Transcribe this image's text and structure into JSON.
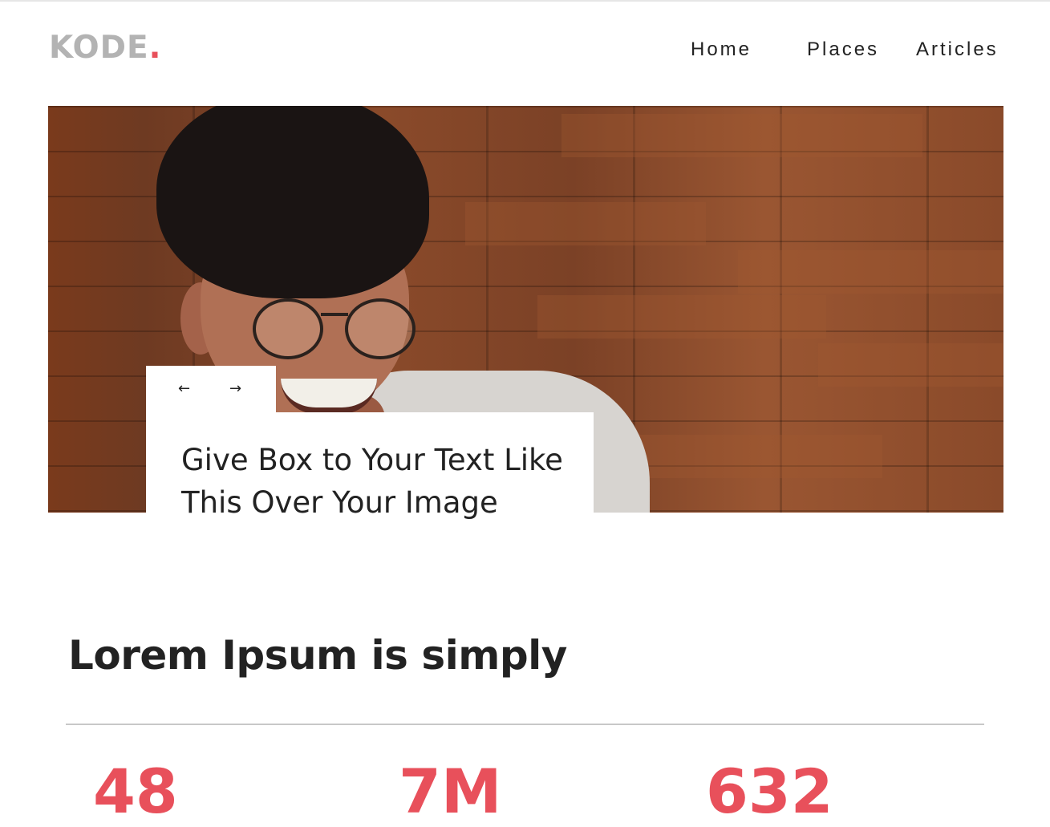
{
  "brand": {
    "name": "KODE",
    "dot": ".",
    "accent_color": "#e8505b"
  },
  "nav": {
    "items": [
      {
        "label": "Home"
      },
      {
        "label": "Places"
      },
      {
        "label": "Articles"
      }
    ]
  },
  "hero": {
    "prev_arrow": "←",
    "next_arrow": "→",
    "caption": "Give Box to Your Text Like This Over Your Image"
  },
  "section": {
    "title": "Lorem Ipsum is simply"
  },
  "stats": [
    {
      "value": "48"
    },
    {
      "value": "7M"
    },
    {
      "value": "632"
    }
  ]
}
